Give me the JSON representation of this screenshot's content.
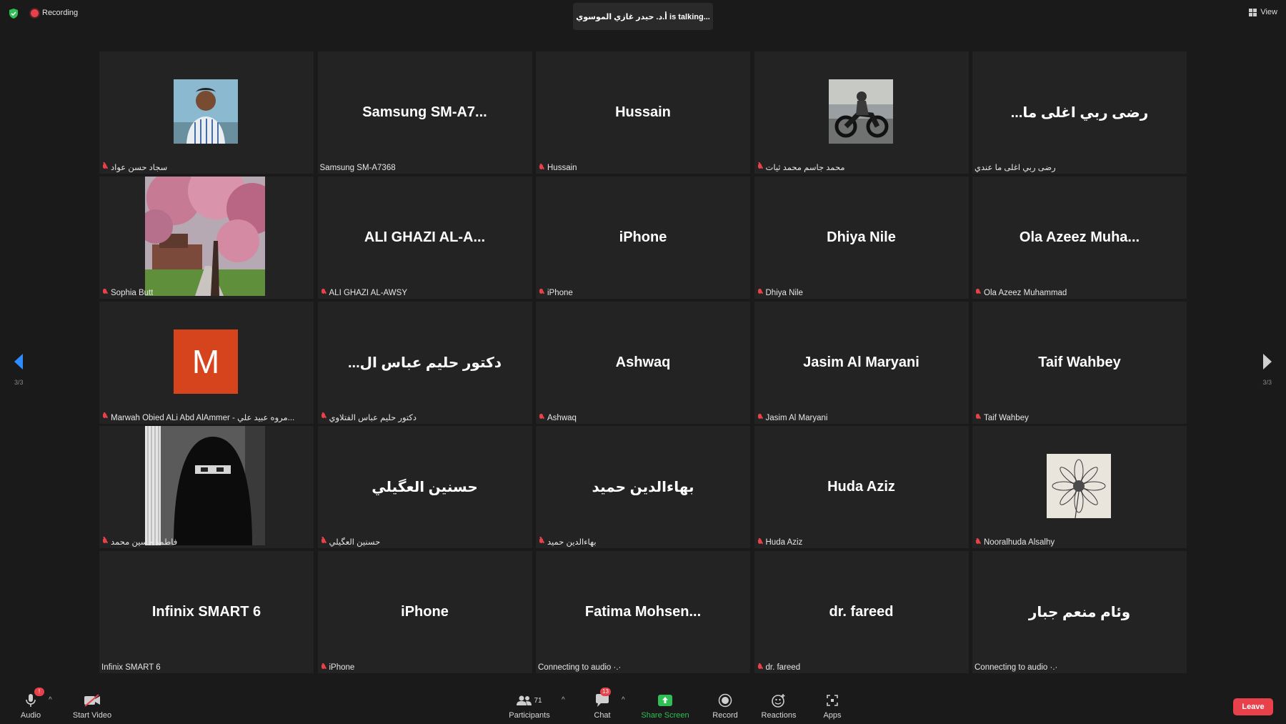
{
  "topbar": {
    "recording_label": "Recording",
    "talking_text": "أ.د. حيدر غازي الموسوي is talking...",
    "view_label": "View"
  },
  "tiles": [
    {
      "display": "",
      "label": "سجاد حسن عواد",
      "muted": true,
      "media": "photo-man"
    },
    {
      "display": "Samsung  SM-A7...",
      "label": "Samsung SM-A7368",
      "muted": false
    },
    {
      "display": "Hussain",
      "label": "Hussain",
      "muted": true
    },
    {
      "display": "",
      "label": "محمد جاسم محمد ثيات",
      "muted": true,
      "media": "photo-motorcycle"
    },
    {
      "display": "...رضى ربي اغلى ما",
      "label": "رضى ربي اغلى ما عندي",
      "muted": false
    },
    {
      "display": "",
      "label": "Sophia Butt",
      "muted": true,
      "media": "photo-blossom"
    },
    {
      "display": "ALI GHAZI AL-A...",
      "label": "ALI GHAZI AL-AWSY",
      "muted": true
    },
    {
      "display": "iPhone",
      "label": "iPhone",
      "muted": true
    },
    {
      "display": "Dhiya Nile",
      "label": "Dhiya Nile",
      "muted": true
    },
    {
      "display": "Ola Azeez Muha...",
      "label": "Ola Azeez Muhammad",
      "muted": true
    },
    {
      "display": "",
      "label": "Marwah Obied ALi Abd AlAmmer - مروه عبيد علي...",
      "muted": true,
      "media": "avatar-letter",
      "avatar_letter": "M",
      "avatar_color": "#d5441c"
    },
    {
      "display": "...دكتور حليم عباس ال",
      "label": "دكتور حليم عباس الفتلاوي",
      "muted": true
    },
    {
      "display": "Ashwaq",
      "label": "Ashwaq",
      "muted": true
    },
    {
      "display": "Jasim Al Maryani",
      "label": "Jasim Al Maryani",
      "muted": true
    },
    {
      "display": "Taif Wahbey",
      "label": "Taif Wahbey",
      "muted": true
    },
    {
      "display": "",
      "label": "فاطمة حسين محمد",
      "muted": true,
      "media": "photo-niqab"
    },
    {
      "display": "حسنين  العگيلي",
      "label": "حسنين العگيلي",
      "muted": true
    },
    {
      "display": "بهاءالدين حميد",
      "label": "بهاءالدين حميد",
      "muted": true
    },
    {
      "display": "Huda Aziz",
      "label": "Huda Aziz",
      "muted": true
    },
    {
      "display": "",
      "label": "Nooralhuda Alsalhy",
      "muted": true,
      "media": "photo-flower"
    },
    {
      "display": "Infinix SMART 6",
      "label": "Infinix SMART 6",
      "muted": false
    },
    {
      "display": "iPhone",
      "label": "iPhone",
      "muted": true
    },
    {
      "display": "Fatima  Mohsen...",
      "label": "Connecting to audio ·.·",
      "muted": false
    },
    {
      "display": "dr. fareed",
      "label": "dr. fareed",
      "muted": true
    },
    {
      "display": "وئام منعم جبار",
      "label": "Connecting to audio ·.·",
      "muted": false
    }
  ],
  "nav": {
    "left_page": "3/3",
    "right_page": "3/3"
  },
  "toolbar": {
    "audio": "Audio",
    "audio_badge": "!",
    "start_video": "Start Video",
    "participants": "Participants",
    "participants_count": "71",
    "chat": "Chat",
    "chat_badge": "13",
    "share_screen": "Share Screen",
    "record": "Record",
    "reactions": "Reactions",
    "apps": "Apps",
    "leave": "Leave"
  },
  "colors": {
    "accent_green": "#2fbf54",
    "alert_red": "#e8414b",
    "background": "#1a1a1a",
    "tile": "#232323"
  }
}
